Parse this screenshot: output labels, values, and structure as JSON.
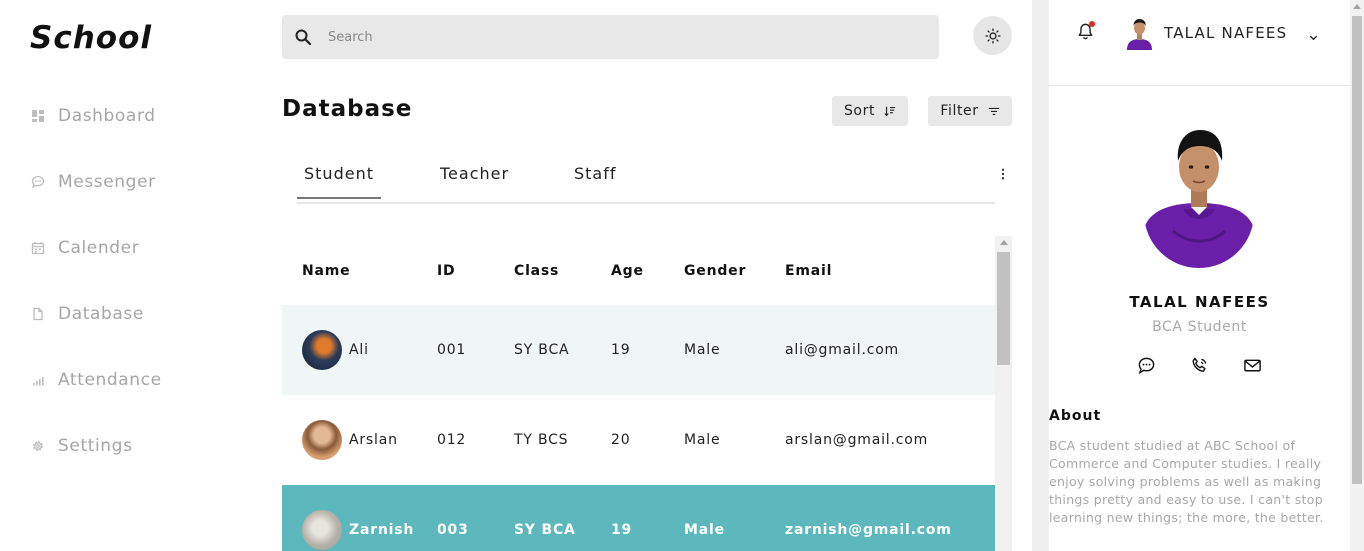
{
  "app": {
    "logo": "School"
  },
  "sidebar": {
    "items": [
      {
        "label": "Dashboard",
        "icon": "grid-icon"
      },
      {
        "label": "Messenger",
        "icon": "chat-bubble-icon"
      },
      {
        "label": "Calender",
        "icon": "calendar-icon"
      },
      {
        "label": "Database",
        "icon": "file-icon"
      },
      {
        "label": "Attendance",
        "icon": "bar-chart-icon"
      },
      {
        "label": "Settings",
        "icon": "gear-icon"
      }
    ]
  },
  "search": {
    "placeholder": "Search",
    "value": ""
  },
  "main": {
    "title": "Database",
    "sort_label": "Sort",
    "filter_label": "Filter",
    "tabs": [
      {
        "label": "Student",
        "active": true
      },
      {
        "label": "Teacher",
        "active": false
      },
      {
        "label": "Staff",
        "active": false
      }
    ]
  },
  "table": {
    "headers": [
      "Name",
      "ID",
      "Class",
      "Age",
      "Gender",
      "Email"
    ],
    "rows": [
      {
        "name": "Ali",
        "id": "001",
        "class": "SY BCA",
        "age": "19",
        "gender": "Male",
        "email": "ali@gmail.com"
      },
      {
        "name": "Arslan",
        "id": "012",
        "class": "TY BCS",
        "age": "20",
        "gender": "Male",
        "email": "arslan@gmail.com"
      },
      {
        "name": "Zarnish",
        "id": "003",
        "class": "SY BCA",
        "age": "19",
        "gender": "Male",
        "email": "zarnish@gmail.com"
      }
    ]
  },
  "user": {
    "name": "TALAL NAFEES"
  },
  "profile": {
    "name": "TALAL NAFEES",
    "role": "BCA Student",
    "about_heading": "About",
    "about_text": "BCA student studied at ABC School of Commerce and Computer studies. I really enjoy solving problems as well as making things pretty and easy to use. I can't stop learning new things; the more, the better."
  },
  "colors": {
    "selected_row": "#5cb8bd",
    "alt_row": "#f0f6f5",
    "notification_dot": "#ee2222",
    "profile_hoodie": "#6a1fa8"
  }
}
